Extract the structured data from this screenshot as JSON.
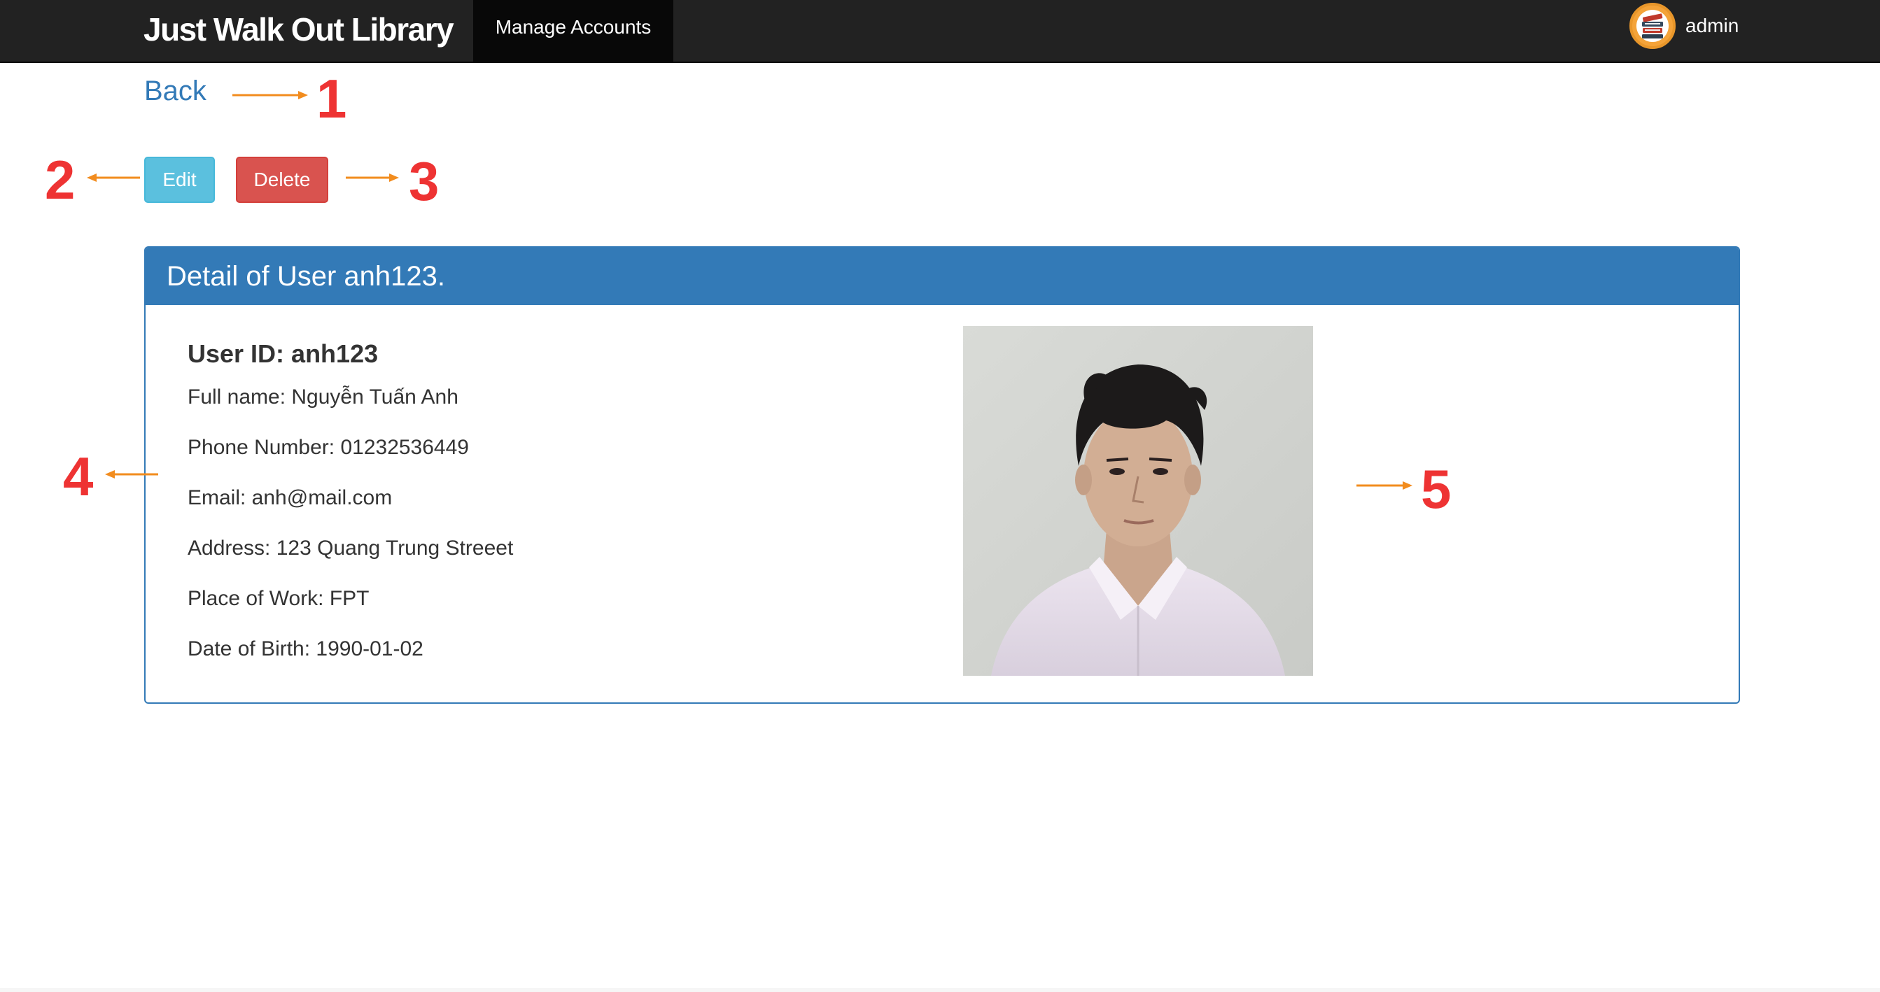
{
  "navbar": {
    "brand": "Just Walk Out Library",
    "active_item": "Manage Accounts",
    "user_name": "admin",
    "avatar_icon": "books-stack-icon"
  },
  "actions": {
    "back_label": "Back",
    "edit_label": "Edit",
    "delete_label": "Delete"
  },
  "panel": {
    "heading": "Detail of User anh123.",
    "user_id": "User ID: anh123",
    "fields": [
      "Full name: Nguyễn Tuấn Anh",
      "Phone Number: 01232536449",
      "Email: anh@mail.com",
      "Address: 123 Quang Trung Streeet",
      "Place of Work: FPT",
      "Date of Birth: 1990-01-02"
    ],
    "photo": "user-portrait-photo"
  },
  "annotations": [
    "1",
    "2",
    "3",
    "4",
    "5"
  ],
  "colors": {
    "navbar": "#222222",
    "primary": "#337ab7",
    "info_button": "#5bc0de",
    "danger_button": "#d9534f",
    "annotation_red": "#ee3333",
    "annotation_arrow": "#f28c1e"
  }
}
